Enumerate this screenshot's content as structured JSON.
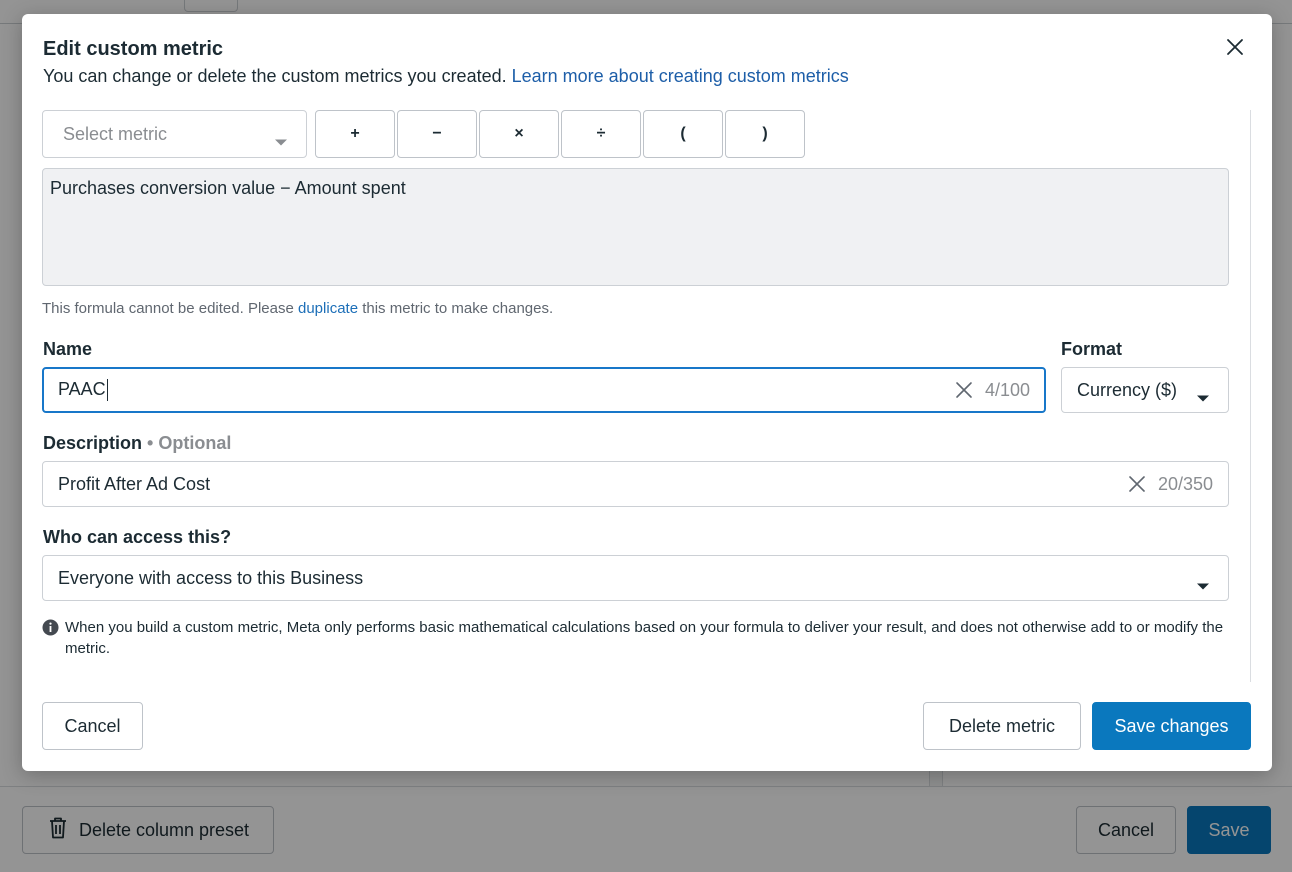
{
  "background": {
    "delete_preset_label": "Delete column preset",
    "cancel_label": "Cancel",
    "save_label": "Save"
  },
  "modal": {
    "title": "Edit custom metric",
    "subtitle": "You can change or delete the custom metrics you created.",
    "learn_more_link": "Learn more about creating custom metrics",
    "select_metric_placeholder": "Select metric",
    "operators": [
      "+",
      "−",
      "×",
      "÷",
      "(",
      ")"
    ],
    "formula": "Purchases conversion value − Amount spent",
    "formula_note_before": "This formula cannot be edited. Please",
    "formula_note_link": "duplicate",
    "formula_note_after": "this metric to make changes.",
    "name_label": "Name",
    "name_value": "PAAC",
    "name_counter": "4/100",
    "format_label": "Format",
    "format_value": "Currency ($)",
    "description_label": "Description",
    "description_optional": "• Optional",
    "description_value": "Profit After Ad Cost",
    "description_counter": "20/350",
    "access_label": "Who can access this?",
    "access_value": "Everyone with access to this Business",
    "info_text": "When you build a custom metric, Meta only performs basic mathematical calculations based on your formula to deliver your result, and does not otherwise add to or modify the metric.",
    "cancel_label": "Cancel",
    "delete_label": "Delete metric",
    "save_label": "Save changes"
  },
  "colors": {
    "primary": "#0a78be",
    "link": "#1d5ea8",
    "focus_border": "#1877c9"
  }
}
